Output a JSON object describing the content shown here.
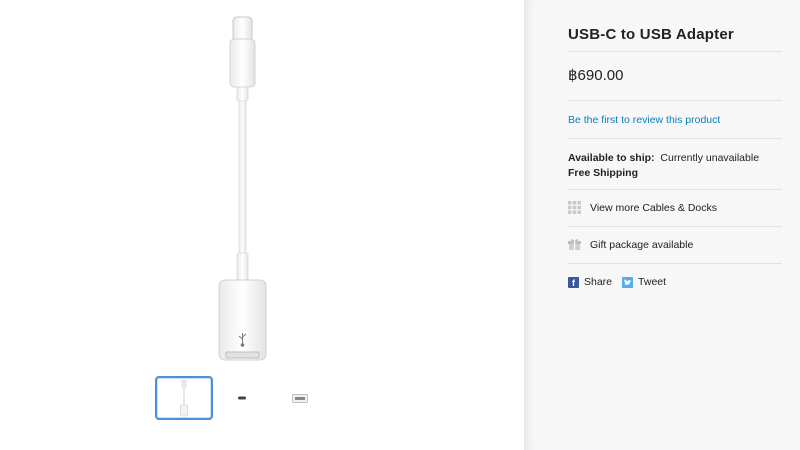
{
  "product": {
    "title": "USB-C to USB Adapter",
    "price": "฿690.00",
    "review_link": "Be the first to review this product",
    "ship_label": "Available to ship:",
    "ship_status": "Currently unavailable",
    "free_shipping": "Free Shipping",
    "more_link": "View more Cables & Docks",
    "gift": "Gift package available"
  },
  "social": {
    "share": "Share",
    "tweet": "Tweet"
  },
  "gallery": {
    "thumbnail_count": 3,
    "active_index": 0
  },
  "colors": {
    "link": "#0b7ec2",
    "active_thumb_border": "#4a90d9",
    "facebook": "#3b5998",
    "twitter": "#55acee"
  },
  "icons": [
    "grid-icon",
    "gift-icon",
    "facebook-icon",
    "twitter-icon",
    "usb-symbol-icon"
  ]
}
